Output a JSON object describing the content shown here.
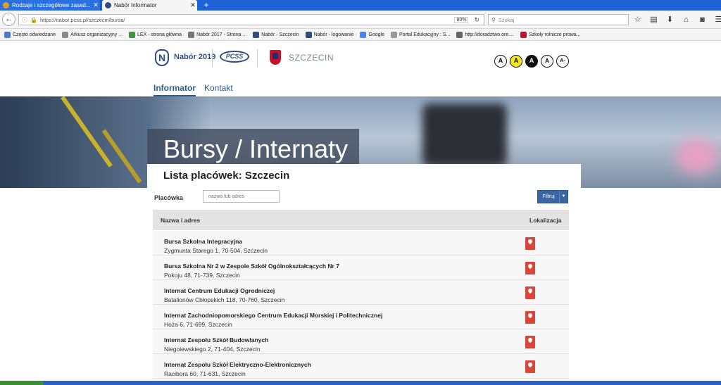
{
  "browser": {
    "tabs": [
      {
        "label": "Rodzaje i szczegółowe zasad..."
      },
      {
        "label": "Nabór Informator"
      }
    ],
    "url": "https://nabor.pcss.pl/szczecin/bursa/",
    "zoom": "80%",
    "search_placeholder": "Szukaj",
    "bookmarks": [
      "Często odwiedzane",
      "Arkusz organizacyjny ...",
      "LEX - strona główna",
      "Nabór 2017 - Strona ...",
      "Nabór - Szczecin",
      "Nabór - logowanie",
      "Google",
      "Portal Edukacyjny : S...",
      "http://doradztwo.ore....",
      "Szkoły rolnicze prowa..."
    ]
  },
  "header": {
    "logo_text": "Nabór 2019",
    "pcss_logo": "PCSS",
    "city": "SZCZECIN",
    "contrast": [
      "A",
      "A",
      "A",
      "A",
      "A-"
    ]
  },
  "menu": {
    "items": [
      "Informator",
      "Kontakt"
    ]
  },
  "hero": {
    "title": "Bursy / Internaty"
  },
  "list": {
    "title": "Lista placówek: Szczecin",
    "filter_label": "Placówka",
    "filter_placeholder": "nazwa lub adres",
    "filter_button": "Filtruj",
    "col_name": "Nazwa i adres",
    "col_location": "Lokalizacja",
    "rows": [
      {
        "name": "Bursa Szkolna Integracyjna",
        "address": "Zygmunta Starego 1, 70-504, Szczecin"
      },
      {
        "name": "Bursa Szkolna Nr 2 w Zespole Szkół Ogólnokształcących Nr 7",
        "address": "Pokoju 48, 71-739, Szczecin"
      },
      {
        "name": "Internat Centrum Edukacji Ogrodniczej",
        "address": "Batalionów Chłopskich 118, 70-760, Szczecin"
      },
      {
        "name": "Internat Zachodniopomorskiego Centrum Edukacji Morskiej i Politechnicznej",
        "address": "Hoża 6, 71-699, Szczecin"
      },
      {
        "name": "Internat Zespołu Szkół Budowlanych",
        "address": "Niegolewskiego 2, 71-404, Szczecin"
      },
      {
        "name": "Internat Zespołu Szkół Elektryczno-Elektronicznych",
        "address": "Racibora 60, 71-631, Szczecin"
      }
    ]
  },
  "colors": {
    "brand": "#2f4d82",
    "button": "#3a66a3",
    "pin": "#d9463a"
  }
}
